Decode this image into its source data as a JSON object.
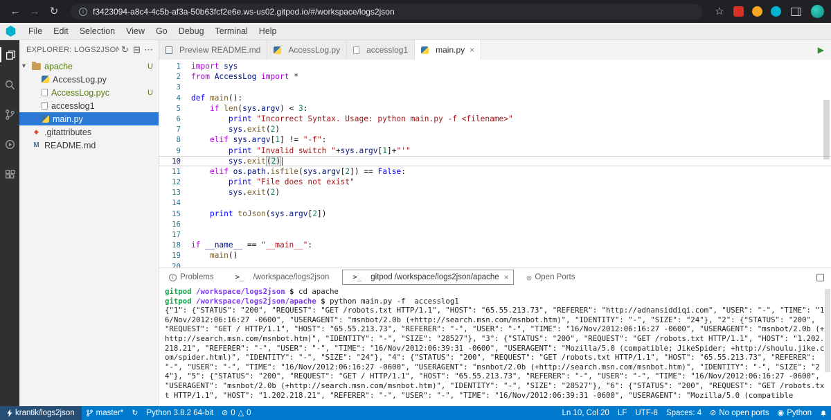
{
  "browser": {
    "url": "f3423094-a8c4-4c5b-af3a-50b63fcf2e6e.ws-us02.gitpod.io/#/workspace/logs2json"
  },
  "menubar": {
    "items": [
      "File",
      "Edit",
      "Selection",
      "View",
      "Go",
      "Debug",
      "Terminal",
      "Help"
    ]
  },
  "explorer": {
    "title": "EXPLORER: LOGS2JSON",
    "tree": [
      {
        "label": "apache",
        "type": "folder",
        "badge": "U",
        "git": true
      },
      {
        "label": "AccessLog.py",
        "type": "python",
        "indent": 1
      },
      {
        "label": "AccessLog.pyc",
        "type": "file",
        "indent": 1,
        "badge": "U",
        "git": true
      },
      {
        "label": "accesslog1",
        "type": "file",
        "indent": 1
      },
      {
        "label": "main.py",
        "type": "python",
        "indent": 1,
        "selected": true
      },
      {
        "label": ".gitattributes",
        "type": "git"
      },
      {
        "label": "README.md",
        "type": "markdown"
      }
    ]
  },
  "tabs": [
    {
      "label": "Preview README.md",
      "icon": "preview"
    },
    {
      "label": "AccessLog.py",
      "icon": "python"
    },
    {
      "label": "accesslog1",
      "icon": "file"
    },
    {
      "label": "main.py",
      "icon": "python",
      "active": true,
      "close": true
    }
  ],
  "editor": {
    "active_line": 10,
    "lines": [
      [
        [
          "import ",
          "k"
        ],
        [
          "sys",
          "v"
        ]
      ],
      [
        [
          "from ",
          "k"
        ],
        [
          "AccessLog",
          "v"
        ],
        [
          " ",
          "p"
        ],
        [
          "import ",
          "k"
        ],
        [
          "*",
          "p"
        ]
      ],
      [],
      [
        [
          "def ",
          "d"
        ],
        [
          "main",
          "f"
        ],
        [
          "():",
          "p"
        ]
      ],
      [
        [
          "    ",
          "p"
        ],
        [
          "if ",
          "k"
        ],
        [
          "len",
          "f"
        ],
        [
          "(",
          "p"
        ],
        [
          "sys",
          "v"
        ],
        [
          ".",
          "p"
        ],
        [
          "argv",
          "v"
        ],
        [
          ") < ",
          "p"
        ],
        [
          "3",
          "n"
        ],
        [
          ":",
          "p"
        ]
      ],
      [
        [
          "        ",
          "p"
        ],
        [
          "print ",
          "d"
        ],
        [
          "\"Incorrect Syntax. Usage: python main.py -f <filename>\"",
          "s"
        ]
      ],
      [
        [
          "        ",
          "p"
        ],
        [
          "sys",
          "v"
        ],
        [
          ".",
          "p"
        ],
        [
          "exit",
          "f"
        ],
        [
          "(",
          "p"
        ],
        [
          "2",
          "n"
        ],
        [
          ")",
          "p"
        ]
      ],
      [
        [
          "    ",
          "p"
        ],
        [
          "elif ",
          "k"
        ],
        [
          "sys",
          "v"
        ],
        [
          ".",
          "p"
        ],
        [
          "argv",
          "v"
        ],
        [
          "[",
          "p"
        ],
        [
          "1",
          "n"
        ],
        [
          "] != ",
          "p"
        ],
        [
          "\"-f\"",
          "s"
        ],
        [
          ":",
          "p"
        ]
      ],
      [
        [
          "        ",
          "p"
        ],
        [
          "print ",
          "d"
        ],
        [
          "\"Invalid switch \"",
          "s"
        ],
        [
          "+",
          "p"
        ],
        [
          "sys",
          "v"
        ],
        [
          ".",
          "p"
        ],
        [
          "argv",
          "v"
        ],
        [
          "[",
          "p"
        ],
        [
          "1",
          "n"
        ],
        [
          "]+",
          "p"
        ],
        [
          "\"'\"",
          "s"
        ]
      ],
      [
        [
          "        ",
          "p"
        ],
        [
          "sys",
          "v"
        ],
        [
          ".",
          "p"
        ],
        [
          "exit",
          "f"
        ],
        [
          "(",
          "p brk-l"
        ],
        [
          "2",
          "n brk-m"
        ],
        [
          ")",
          "p brk-r"
        ]
      ],
      [
        [
          "    ",
          "p"
        ],
        [
          "elif ",
          "k"
        ],
        [
          "os",
          "v"
        ],
        [
          ".",
          "p"
        ],
        [
          "path",
          "v"
        ],
        [
          ".",
          "p"
        ],
        [
          "isfile",
          "f"
        ],
        [
          "(",
          "p"
        ],
        [
          "sys",
          "v"
        ],
        [
          ".",
          "p"
        ],
        [
          "argv",
          "v"
        ],
        [
          "[",
          "p"
        ],
        [
          "2",
          "n"
        ],
        [
          "]) == ",
          "p"
        ],
        [
          "False",
          "d"
        ],
        [
          ":",
          "p"
        ]
      ],
      [
        [
          "        ",
          "p"
        ],
        [
          "print ",
          "d"
        ],
        [
          "\"File does not exist\"",
          "s"
        ]
      ],
      [
        [
          "        ",
          "p"
        ],
        [
          "sys",
          "v"
        ],
        [
          ".",
          "p"
        ],
        [
          "exit",
          "f"
        ],
        [
          "(",
          "p"
        ],
        [
          "2",
          "n"
        ],
        [
          ")",
          "p"
        ]
      ],
      [],
      [
        [
          "    ",
          "p"
        ],
        [
          "print ",
          "d"
        ],
        [
          "toJson",
          "f"
        ],
        [
          "(",
          "p"
        ],
        [
          "sys",
          "v"
        ],
        [
          ".",
          "p"
        ],
        [
          "argv",
          "v"
        ],
        [
          "[",
          "p"
        ],
        [
          "2",
          "n"
        ],
        [
          "])",
          "p"
        ]
      ],
      [],
      [],
      [
        [
          "if ",
          "k"
        ],
        [
          "__name__",
          "v"
        ],
        [
          " == ",
          "p"
        ],
        [
          "\"__main__\"",
          "s"
        ],
        [
          ":",
          "p"
        ]
      ],
      [
        [
          "    ",
          "p"
        ],
        [
          "main",
          "f"
        ],
        [
          "()",
          "p"
        ]
      ],
      []
    ]
  },
  "panel": {
    "tabs": [
      {
        "label": "Problems",
        "icon": "problems"
      },
      {
        "label": "/workspace/logs2json",
        "icon": "terminal"
      },
      {
        "label": "gitpod /workspace/logs2json/apache",
        "icon": "terminal",
        "active": true,
        "close": true
      },
      {
        "label": "Open Ports",
        "icon": "ports"
      }
    ]
  },
  "terminal": {
    "lines": [
      [
        [
          "gitpod ",
          "g"
        ],
        [
          "/workspace/logs2json ",
          "u"
        ],
        [
          "$ ",
          "t"
        ],
        [
          "cd apache",
          "c"
        ]
      ],
      [
        [
          "gitpod ",
          "g"
        ],
        [
          "/workspace/logs2json/apache ",
          "u"
        ],
        [
          "$ ",
          "t"
        ],
        [
          "python main.py -f  accesslog1",
          "c"
        ]
      ]
    ],
    "output": "{\"1\": {\"STATUS\": \"200\", \"REQUEST\": \"GET /robots.txt HTTP/1.1\", \"HOST\": \"65.55.213.73\", \"REFERER\": \"http://adnansiddiqi.com\", \"USER\": \"-\", \"TIME\": \"16/Nov/2012:06:16:27 -0600\", \"USERAGENT\": \"msnbot/2.0b (+http://search.msn.com/msnbot.htm)\", \"IDENTITY\": \"-\", \"SIZE\": \"24\"}, \"2\": {\"STATUS\": \"200\", \"REQUEST\": \"GET / HTTP/1.1\", \"HOST\": \"65.55.213.73\", \"REFERER\": \"-\", \"USER\": \"-\", \"TIME\": \"16/Nov/2012:06:16:27 -0600\", \"USERAGENT\": \"msnbot/2.0b (+http://search.msn.com/msnbot.htm)\", \"IDENTITY\": \"-\", \"SIZE\": \"28527\"}, \"3\": {\"STATUS\": \"200\", \"REQUEST\": \"GET /robots.txt HTTP/1.1\", \"HOST\": \"1.202.218.21\", \"REFERER\": \"-\", \"USER\": \"-\", \"TIME\": \"16/Nov/2012:06:39:31 -0600\", \"USERAGENT\": \"Mozilla/5.0 (compatible; JikeSpider; +http://shoulu.jike.com/spider.html)\", \"IDENTITY\": \"-\", \"SIZE\": \"24\"}, \"4\": {\"STATUS\": \"200\", \"REQUEST\": \"GET /robots.txt HTTP/1.1\", \"HOST\": \"65.55.213.73\", \"REFERER\": \"-\", \"USER\": \"-\", \"TIME\": \"16/Nov/2012:06:16:27 -0600\", \"USERAGENT\": \"msnbot/2.0b (+http://search.msn.com/msnbot.htm)\", \"IDENTITY\": \"-\", \"SIZE\": \"24\"}, \"5\": {\"STATUS\": \"200\", \"REQUEST\": \"GET / HTTP/1.1\", \"HOST\": \"65.55.213.73\", \"REFERER\": \"-\", \"USER\": \"-\", \"TIME\": \"16/Nov/2012:06:16:27 -0600\", \"USERAGENT\": \"msnbot/2.0b (+http://search.msn.com/msnbot.htm)\", \"IDENTITY\": \"-\", \"SIZE\": \"28527\"}, \"6\": {\"STATUS\": \"200\", \"REQUEST\": \"GET /robots.txt HTTP/1.1\", \"HOST\": \"1.202.218.21\", \"REFERER\": \"-\", \"USER\": \"-\", \"TIME\": \"16/Nov/2012:06:39:31 -0600\", \"USERAGENT\": \"Mozilla/5.0 (compatible"
  },
  "statusbar": {
    "left": [
      {
        "name": "remote-indicator",
        "icon": "lightning",
        "label": "krantik/logs2json",
        "cls": "remote"
      },
      {
        "name": "git-branch-indicator",
        "icon": "branch",
        "label": "master*"
      },
      {
        "name": "sync-changes-button",
        "icon": "sync"
      },
      {
        "name": "python-interpreter",
        "label": "Python 3.8.2 64-bit"
      },
      {
        "name": "problems-counts",
        "icon": "error",
        "label": "0",
        "icon2": "warning",
        "label2": "0"
      }
    ],
    "right": [
      {
        "name": "cursor-position",
        "label": "Ln 10, Col 20"
      },
      {
        "name": "eol-sequence",
        "label": "LF"
      },
      {
        "name": "file-encoding",
        "label": "UTF-8"
      },
      {
        "name": "indentation",
        "label": "Spaces: 4"
      },
      {
        "name": "open-ports",
        "icon": "circleSlash",
        "label": "No open ports"
      },
      {
        "name": "python-language-status",
        "icon": "broadcast",
        "label": "Python"
      },
      {
        "name": "notifications-bell",
        "icon": "bell"
      }
    ]
  }
}
